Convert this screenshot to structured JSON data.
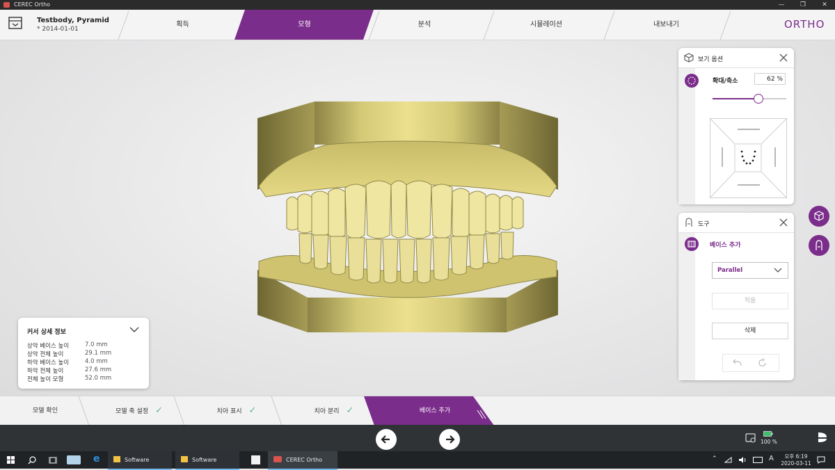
{
  "window": {
    "title": "CEREC Ortho"
  },
  "project": {
    "name": "Testbody, Pyramid",
    "date": "* 2014-01-01"
  },
  "tabs": [
    {
      "label": "획득",
      "active": false
    },
    {
      "label": "모형",
      "active": true
    },
    {
      "label": "분석",
      "active": false
    },
    {
      "label": "시뮬레이션",
      "active": false
    },
    {
      "label": "내보내기",
      "active": false
    }
  ],
  "brand": "ORTHO",
  "colors": {
    "accent": "#7b2d8b",
    "model": "#d8cc80"
  },
  "info_panel": {
    "title": "커서 상세 정보",
    "rows": [
      {
        "label": "상악 베이스 높이",
        "value": "7.0 mm"
      },
      {
        "label": "상악 전체 높이",
        "value": "29.1 mm"
      },
      {
        "label": "하악 베이스 높이",
        "value": "4.0 mm"
      },
      {
        "label": "하악 전체 높이",
        "value": "27.6 mm"
      },
      {
        "label": "전체 높이 모형",
        "value": "52.0 mm"
      }
    ]
  },
  "view_panel": {
    "title": "보기 옵션",
    "zoom_label": "확대/축소",
    "zoom_value": "62 %",
    "zoom_fraction": 0.62
  },
  "tools_panel": {
    "title": "도구",
    "tool_name": "베이스 추가",
    "select_value": "Parallel",
    "apply_label": "적용",
    "delete_label": "삭제"
  },
  "steps": [
    {
      "label": "모델 확인",
      "done": false
    },
    {
      "label": "모델 축 설정",
      "done": true
    },
    {
      "label": "치아 표시",
      "done": true
    },
    {
      "label": "치아 분리",
      "done": true
    },
    {
      "label": "베이스 추가",
      "done": false,
      "active": true
    }
  ],
  "status": {
    "battery": "100 %"
  },
  "taskbar": {
    "items": [
      "Software",
      "Software",
      "CEREC Ortho"
    ],
    "time": "오후 6:19",
    "date": "2020-03-11",
    "ime": "A"
  }
}
